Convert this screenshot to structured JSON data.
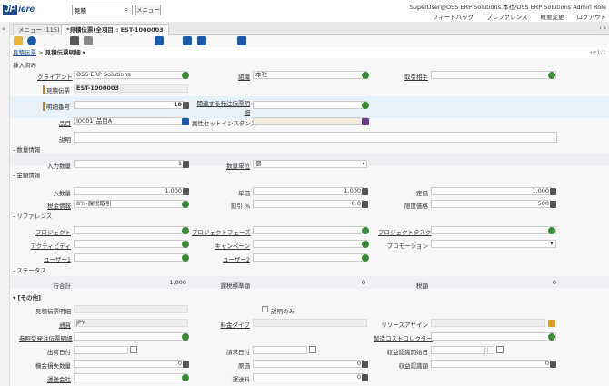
{
  "header": {
    "search_value": "見積",
    "menu_label": "メニュー",
    "user": "SuperUser@OSS ERP Solutions.本社/OSS ERP Solutions Admin Role",
    "links": [
      "フィードバック",
      "プレファレンス",
      "概要変更",
      "ログアウト"
    ]
  },
  "tabs": [
    {
      "label": "メニュー (115)"
    },
    {
      "label": "*見積伝票(全項目): EST-1000003"
    }
  ],
  "breadcrumb": {
    "parent": "見積伝票",
    "current": "見積伝票明細",
    "nav": "+*1/1"
  },
  "status": {
    "label": "挿入済み"
  },
  "sections": {
    "quantity": "- 数量情報",
    "amount": "- 金額情報",
    "reference": "- リファレンス",
    "status": "- ステータス",
    "other": "▾ [その他]"
  },
  "fields": {
    "client_label": "クライアント",
    "client": "OSS ERP Solutions",
    "org_label": "組織",
    "org": "本社",
    "bpartner_label": "取引相手",
    "bpartner": "",
    "doc_label": "見積伝票",
    "doc": "EST-1000003",
    "related_label": "関連する発注伝票明細",
    "related": "",
    "line_label": "明細番号",
    "line": "10",
    "product_label": "品目",
    "product": "I0001_品目A",
    "attr_label": "属性セットインスタンス",
    "attr": "",
    "desc_label": "説明",
    "desc": "",
    "qty_label": "入力数量",
    "qty": "1",
    "uom_label": "数量単位",
    "uom": "個",
    "qtyentered_label": "入数量",
    "qtyentered": "1,000",
    "price_label": "単価",
    "price": "1,000",
    "list_label": "定価",
    "list": "1,000",
    "tax_label": "税金情報",
    "tax": "8%-課税取引",
    "discount_label": "割引 %",
    "discount": "0.0",
    "limit_label": "限度価格",
    "limit": "500",
    "project_label": "プロジェクト",
    "project": "",
    "phase_label": "プロジェクトフェーズ",
    "phase": "",
    "task_label": "プロジェクトタスク",
    "task": "",
    "activity_label": "アクティビティ",
    "activity": "",
    "campaign_label": "キャンペーン",
    "campaign": "",
    "promo_label": "プロモーション",
    "promo": "",
    "user1_label": "ユーザー1",
    "user1": "",
    "user2_label": "ユーザー2",
    "user2": "",
    "linetotal_label": "行合計",
    "linetotal": "1,000",
    "taxbase_label": "課税標準額",
    "taxbase": "0",
    "taxamt_label": "税額",
    "taxamt": "0",
    "estline_label": "見積伝票明細",
    "estline": "",
    "descOnly_label": "説明のみ",
    "currency_label": "通貨",
    "currency": "JPY",
    "charge_label": "料金タイプ",
    "charge": "",
    "resource_label": "リソースアサイン",
    "resource": "",
    "refpo_label": "参照受発注伝票明細",
    "refpo": "",
    "costcol_label": "製造コストコレクター",
    "costcol": "",
    "shipdate_label": "出荷日付",
    "shipdate": "",
    "invdate_label": "請求日付",
    "invdate": "",
    "revstart_label": "収益認識開始日",
    "revstart": "",
    "lostqty_label": "機会損失数量",
    "lostqty": "0",
    "cost_label": "原価",
    "cost": "0",
    "revamt_label": "収益認識額",
    "revamt": "0",
    "shipper_label": "運送会社",
    "shipper": "",
    "freight_label": "運送料",
    "freight": "0"
  }
}
